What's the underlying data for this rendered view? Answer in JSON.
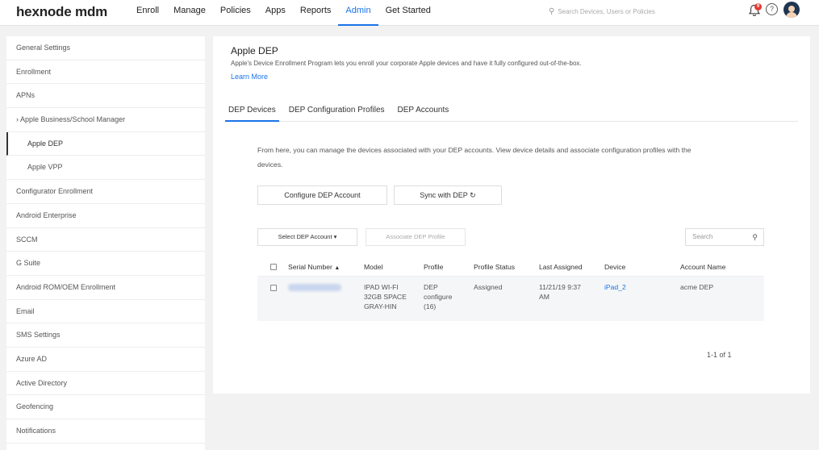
{
  "app": {
    "logo": "hexnode mdm"
  },
  "nav": {
    "items": [
      "Enroll",
      "Manage",
      "Policies",
      "Apps",
      "Reports",
      "Admin",
      "Get Started"
    ],
    "active": "Admin",
    "search_placeholder": "Search Devices, Users or Policies",
    "notification_count": "9",
    "help_glyph": "?"
  },
  "sidebar": {
    "items": [
      "General Settings",
      "Enrollment",
      "APNs",
      "Apple Business/School Manager",
      "Apple DEP",
      "Apple VPP",
      "Configurator Enrollment",
      "Android Enterprise",
      "SCCM",
      "G Suite",
      "Android ROM/OEM Enrollment",
      "Email",
      "SMS Settings",
      "Azure AD",
      "Active Directory",
      "Geofencing",
      "Notifications"
    ],
    "active": "Apple DEP"
  },
  "main": {
    "title": "Apple DEP",
    "description": "Apple's Device Enrollment Program lets you enroll your corporate Apple devices and have it fully configured out-of-the-box.",
    "learn_more": "Learn More",
    "tabs": [
      "DEP Devices",
      "DEP Configuration Profiles",
      "DEP Accounts"
    ],
    "active_tab": "DEP Devices",
    "intro_line1": "From here, you can manage the devices associated with your DEP accounts. View device details and associate configuration profiles with the",
    "intro_line2": "devices.",
    "configure_button": "Configure DEP Account",
    "sync_button": "Sync with DEP",
    "select_account": "Select DEP Account",
    "associate_profile": "Associate DEP Profile",
    "search_placeholder": "Search",
    "table": {
      "headers": [
        "Serial Number",
        "Model",
        "Profile",
        "Profile Status",
        "Last Assigned",
        "Device",
        "Account Name"
      ],
      "sort_indicator": "▲",
      "rows": [
        {
          "serial": "",
          "model": [
            "IPAD WI-FI",
            "32GB SPACE",
            "GRAY-HIN"
          ],
          "profile": [
            "DEP",
            "configure",
            "(16)"
          ],
          "profile_status": "Assigned",
          "last_assigned": [
            "11/21/19 9:37",
            "AM"
          ],
          "device": "iPad_2",
          "account_name": "acme DEP"
        }
      ]
    },
    "pagination": "1-1 of 1"
  }
}
